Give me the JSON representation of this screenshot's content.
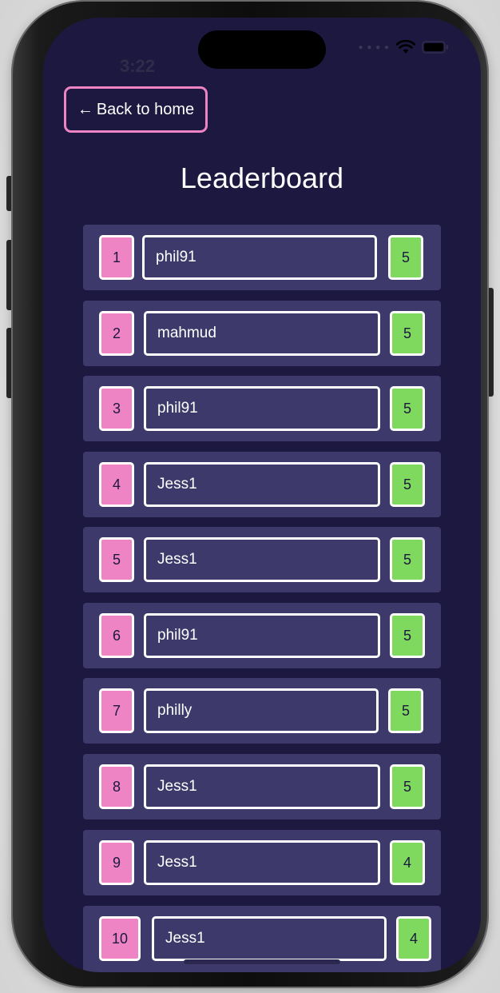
{
  "status_bar": {
    "time": "3:22",
    "signal_icon": "cellular-dots-icon",
    "wifi_icon": "wifi-icon",
    "battery_icon": "battery-icon"
  },
  "header": {
    "back_label": "Back to home",
    "back_icon": "arrow-left-icon",
    "title": "Leaderboard"
  },
  "colors": {
    "background": "#1c1840",
    "row_background": "#3d3a6b",
    "rank_badge": "#ef84c4",
    "score_badge": "#7ed95e",
    "back_border": "#ef84c4"
  },
  "leaderboard": {
    "rows": [
      {
        "rank": "1",
        "name": "phil91",
        "score": "5"
      },
      {
        "rank": "2",
        "name": "mahmud",
        "score": "5"
      },
      {
        "rank": "3",
        "name": "phil91",
        "score": "5"
      },
      {
        "rank": "4",
        "name": "Jess1",
        "score": "5"
      },
      {
        "rank": "5",
        "name": "Jess1",
        "score": "5"
      },
      {
        "rank": "6",
        "name": "phil91",
        "score": "5"
      },
      {
        "rank": "7",
        "name": "philly",
        "score": "5"
      },
      {
        "rank": "8",
        "name": "Jess1",
        "score": "5"
      },
      {
        "rank": "9",
        "name": "Jess1",
        "score": "4"
      },
      {
        "rank": "10",
        "name": "Jess1",
        "score": "4"
      }
    ]
  }
}
